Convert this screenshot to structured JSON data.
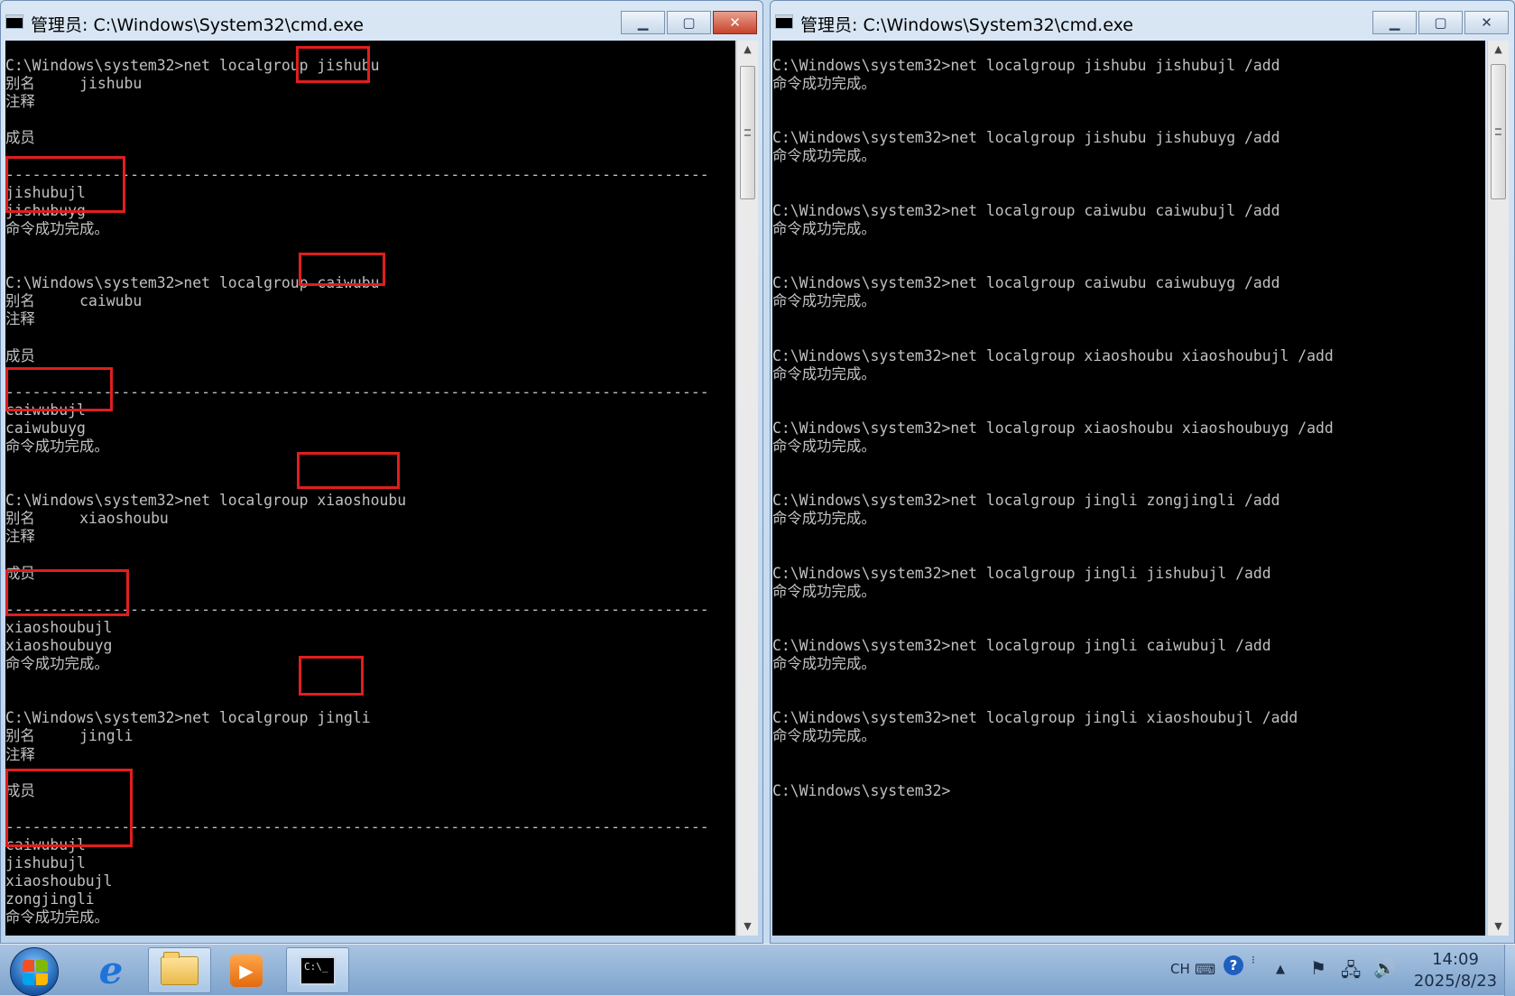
{
  "left_window": {
    "title": "管理员: C:\\Windows\\System32\\cmd.exe",
    "controls": {
      "minimize": "▁",
      "maximize": "▢",
      "close": "✕"
    },
    "lines": [
      "C:\\Windows\\system32>net localgroup jishubu",
      "别名     jishubu",
      "注释",
      "",
      "成员",
      "",
      "-------------------------------------------------------------------------------",
      "jishubujl",
      "jishubuyg",
      "命令成功完成。",
      "",
      "",
      "C:\\Windows\\system32>net localgroup caiwubu",
      "别名     caiwubu",
      "注释",
      "",
      "成员",
      "",
      "-------------------------------------------------------------------------------",
      "caiwubujl",
      "caiwubuyg",
      "命令成功完成。",
      "",
      "",
      "C:\\Windows\\system32>net localgroup xiaoshoubu",
      "别名     xiaoshoubu",
      "注释",
      "",
      "成员",
      "",
      "-------------------------------------------------------------------------------",
      "xiaoshoubujl",
      "xiaoshoubuyg",
      "命令成功完成。",
      "",
      "",
      "C:\\Windows\\system32>net localgroup jingli",
      "别名     jingli",
      "注释",
      "",
      "成员",
      "",
      "-------------------------------------------------------------------------------",
      "caiwubujl",
      "jishubujl",
      "xiaoshoubujl",
      "zongjingli",
      "命令成功完成。"
    ]
  },
  "right_window": {
    "title": "管理员: C:\\Windows\\System32\\cmd.exe",
    "controls": {
      "minimize": "▁",
      "maximize": "▢",
      "close": "✕"
    },
    "lines": [
      "C:\\Windows\\system32>net localgroup jishubu jishubujl /add",
      "命令成功完成。",
      "",
      "",
      "C:\\Windows\\system32>net localgroup jishubu jishubuyg /add",
      "命令成功完成。",
      "",
      "",
      "C:\\Windows\\system32>net localgroup caiwubu caiwubujl /add",
      "命令成功完成。",
      "",
      "",
      "C:\\Windows\\system32>net localgroup caiwubu caiwubuyg /add",
      "命令成功完成。",
      "",
      "",
      "C:\\Windows\\system32>net localgroup xiaoshoubu xiaoshoubujl /add",
      "命令成功完成。",
      "",
      "",
      "C:\\Windows\\system32>net localgroup xiaoshoubu xiaoshoubuyg /add",
      "命令成功完成。",
      "",
      "",
      "C:\\Windows\\system32>net localgroup jingli zongjingli /add",
      "命令成功完成。",
      "",
      "",
      "C:\\Windows\\system32>net localgroup jingli jishubujl /add",
      "命令成功完成。",
      "",
      "",
      "C:\\Windows\\system32>net localgroup jingli caiwubujl /add",
      "命令成功完成。",
      "",
      "",
      "C:\\Windows\\system32>net localgroup jingli xiaoshoubujl /add",
      "命令成功完成。",
      "",
      "",
      "C:\\Windows\\system32>"
    ]
  },
  "taskbar": {
    "cmd_icon_text": "C:\\_",
    "language": "CH",
    "help_icon": "?",
    "tray_arrow": "▲",
    "clock_time": "14:09",
    "clock_date": "2025/8/23"
  },
  "colors": {
    "console_bg": "#000000",
    "console_text": "#c0c0c0",
    "highlight_box": "#e01e1e",
    "close_button": "#c7422b"
  }
}
